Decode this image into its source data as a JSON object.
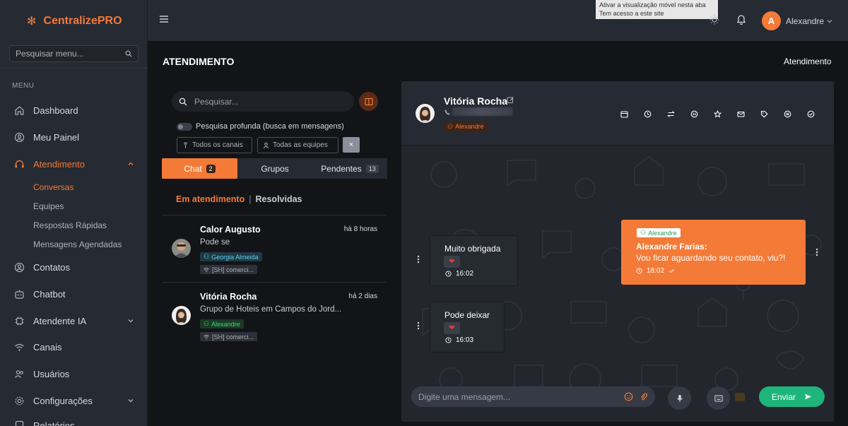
{
  "app": {
    "brand": "CentralizePRO"
  },
  "sidebar": {
    "search_placeholder": "Pesquisar menu...",
    "menu_title": "MENU",
    "items": [
      {
        "label": "Dashboard",
        "icon": "home-icon"
      },
      {
        "label": "Meu Painel",
        "icon": "user-circle-icon"
      },
      {
        "label": "Atendimento",
        "icon": "headset-icon"
      },
      {
        "label": "Contatos",
        "icon": "contact-icon"
      },
      {
        "label": "Chatbot",
        "icon": "bot-icon"
      },
      {
        "label": "Atendente IA",
        "icon": "ai-icon"
      },
      {
        "label": "Canais",
        "icon": "wifi-icon"
      },
      {
        "label": "Usuários",
        "icon": "users-icon"
      },
      {
        "label": "Configurações",
        "icon": "gear-icon"
      },
      {
        "label": "Relatórios",
        "icon": "report-icon"
      }
    ],
    "sub_items": [
      "Conversas",
      "Equipes",
      "Respostas Rápidas",
      "Mensagens Agendadas"
    ]
  },
  "topbar": {
    "tooltip_line1": "Ativar a visualização móvel nesta aba",
    "tooltip_line2": "Tem acesso a este site",
    "avatar_letter": "A",
    "user_name": "Alexandre"
  },
  "page": {
    "title": "ATENDIMENTO",
    "breadcrumb": "Atendimento"
  },
  "conversations": {
    "search_placeholder": "Pesquisar...",
    "deep_search_label": "Pesquisa profunda (busca em mensagens)",
    "filter_channels": "Todos os canais",
    "filter_teams": "Todas as equipes",
    "clear_label": "×",
    "tabs": [
      {
        "label": "Chat",
        "badge": "2"
      },
      {
        "label": "Grupos",
        "badge": ""
      },
      {
        "label": "Pendentes",
        "badge": "13"
      }
    ],
    "subtab_active": "Em atendimento",
    "subtab_sep": "|",
    "subtab_other": "Resolvidas",
    "items": [
      {
        "name": "Calor Augusto",
        "time": "há 8 horas",
        "message": "Pode se",
        "agent": "Georgia Almeida",
        "channel": "[SH] comerci..."
      },
      {
        "name": "Vitória Rocha",
        "time": "há 2 dias",
        "message": "Grupo de Hoteis em Campos do Jord...",
        "agent": "Alexandre",
        "channel": "[SH] comerci..."
      }
    ]
  },
  "chat": {
    "contact_name": "Vitória Rocha",
    "agent_tag": "Alexandre",
    "actions": [
      {
        "name": "calendar-action-icon",
        "color": "#f47a37"
      },
      {
        "name": "clock-action-icon",
        "color": "#6b7280"
      },
      {
        "name": "transfer-action-icon",
        "color": "#3b9ae1"
      },
      {
        "name": "pause-action-icon",
        "color": "#6b7280"
      },
      {
        "name": "star-action-icon",
        "color": "#f0b429"
      },
      {
        "name": "mail-action-icon",
        "color": "#6b7280"
      },
      {
        "name": "tag-action-icon",
        "color": "#8b5cf6"
      },
      {
        "name": "close-action-icon",
        "color": "#e05d6f"
      },
      {
        "name": "check-action-icon",
        "color": "#22b07d"
      }
    ],
    "outgoing": {
      "tag": "Alexandre",
      "sender": "Alexandre Farias:",
      "text": "Vou ficar aguardando seu contato, viu?!",
      "time": "18:02"
    },
    "incoming": [
      {
        "text": "Muito obrigada",
        "reaction": "❤",
        "time": "16:02"
      },
      {
        "text": "Pode deixar",
        "reaction": "❤",
        "time": "16:03"
      }
    ],
    "composer_placeholder": "Digite uma mensagem...",
    "send_label": "Enviar"
  },
  "colors": {
    "accent": "#f47a37",
    "send": "#1eb57a",
    "sidebar_bg": "#262a33",
    "page_bg": "#131417"
  }
}
